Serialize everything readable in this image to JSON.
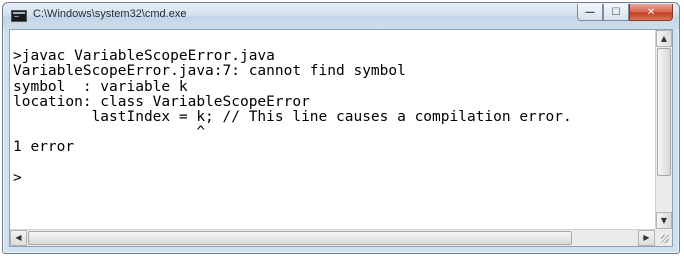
{
  "window": {
    "title": "C:\\Windows\\system32\\cmd.exe",
    "app_icon": "console-icon",
    "controls": {
      "minimize": "—",
      "maximize": "☐",
      "close": "✕"
    }
  },
  "console": {
    "lines": [
      "",
      ">javac VariableScopeError.java",
      "VariableScopeError.java:7: cannot find symbol",
      "symbol  : variable k",
      "location: class VariableScopeError",
      "         lastIndex = k; // This line causes a compilation error.",
      "                     ^",
      "1 error",
      "",
      ">"
    ]
  },
  "scrollbars": {
    "up_arrow": "▲",
    "down_arrow": "▼",
    "left_arrow": "◀",
    "right_arrow": "▶"
  },
  "colors": {
    "titlebar": "#cfdeec",
    "close_button": "#c33c1f",
    "console_background": "#ffffff",
    "console_text": "#000000"
  }
}
